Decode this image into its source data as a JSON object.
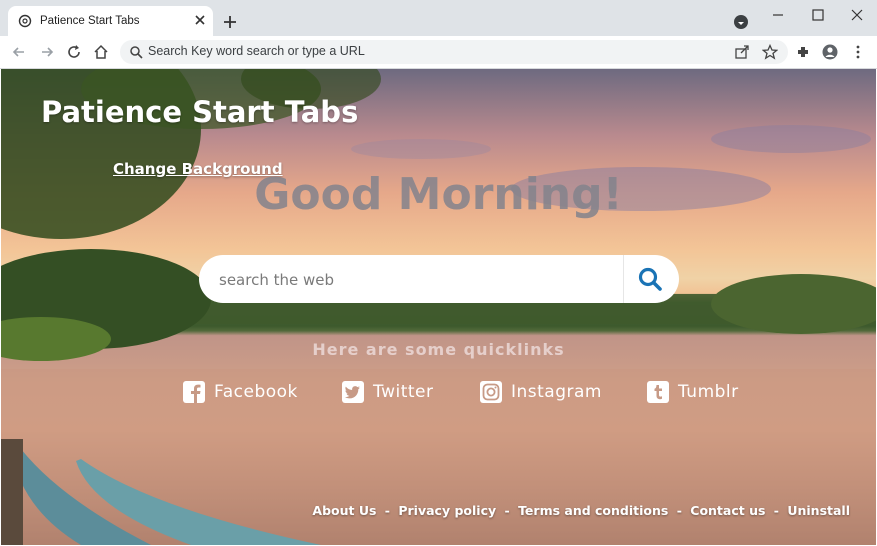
{
  "browser": {
    "tab_title": "Patience Start Tabs",
    "address_placeholder": "Search Key word search or type a URL"
  },
  "page": {
    "brand": "Patience Start Tabs",
    "change_background": "Change Background",
    "greeting": "Good Morning!",
    "search_placeholder": "search the web",
    "quicklinks_title": "Here are some quicklinks",
    "quicklinks": [
      {
        "label": "Facebook",
        "icon": "facebook-icon"
      },
      {
        "label": "Twitter",
        "icon": "twitter-icon"
      },
      {
        "label": "Instagram",
        "icon": "instagram-icon"
      },
      {
        "label": "Tumblr",
        "icon": "tumblr-icon"
      }
    ],
    "footer": {
      "about": "About Us",
      "privacy": "Privacy policy",
      "terms": "Terms and conditions",
      "contact": "Contact us",
      "uninstall": "Uninstall",
      "separator": "-"
    }
  },
  "colors": {
    "search_icon": "#1a73b5",
    "tab_bar": "#dfe3e7"
  }
}
